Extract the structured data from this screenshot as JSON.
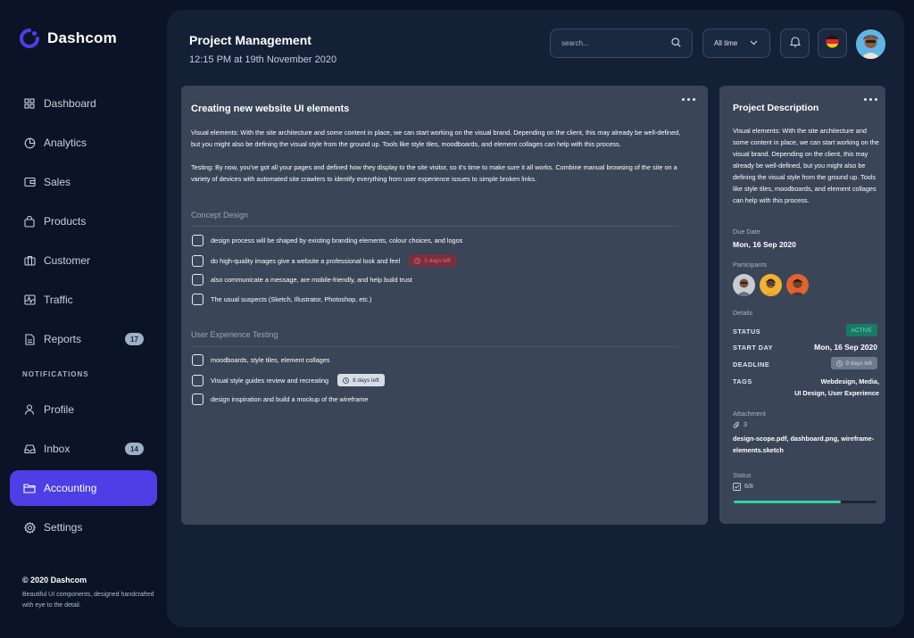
{
  "brand": {
    "name": "Dashcom",
    "accent": "#4d3ee6"
  },
  "nav": {
    "items": [
      {
        "label": "Dashboard",
        "icon": "grid-icon"
      },
      {
        "label": "Analytics",
        "icon": "pie-chart-icon"
      },
      {
        "label": "Sales",
        "icon": "wallet-icon"
      },
      {
        "label": "Products",
        "icon": "shopping-bag-icon"
      },
      {
        "label": "Customer",
        "icon": "briefcase-icon"
      },
      {
        "label": "Traffic",
        "icon": "activity-icon"
      },
      {
        "label": "Reports",
        "icon": "document-icon",
        "badge": "17"
      }
    ],
    "section_label": "NOTIFICATIONS",
    "items2": [
      {
        "label": "Profile",
        "icon": "user-icon"
      },
      {
        "label": "Inbox",
        "icon": "inbox-icon",
        "badge": "14"
      },
      {
        "label": "Accounting",
        "icon": "folder-icon",
        "active": true
      },
      {
        "label": "Settings",
        "icon": "gear-icon"
      }
    ]
  },
  "footer": {
    "copyright": "© 2020 Dashcom",
    "description": "Beautiful UI components, designed handcrafted with eye to the detail."
  },
  "header": {
    "title": "Project Management",
    "subtitle": "12:15 PM at 19th November 2020",
    "search_placeholder": "search...",
    "filter_label": "All time"
  },
  "task": {
    "title": "Creating new website UI elements",
    "paragraph1": "Visual elements: With the site architecture and some content in place, we can start working on the visual brand. Depending on the client, this may already be well-defined, but you might also be defining the visual style from the ground up. Tools like style tiles, moodboards, and element collages can help with this process.",
    "paragraph2": "Testing: By now, you've got all your pages and defined how they display to the site visitor, so it's time to make sure it all works. Combine manual browsing of the site on a variety of devices with automated site crawlers to identify everything from user experience issues to simple broken links.",
    "section1": {
      "title": "Concept Design",
      "items": [
        {
          "text": "design process will  be shaped by existing branding elements, colour choices, and logos"
        },
        {
          "text": "do high-quality images give a website a professional look and feel",
          "pill": "3 days left"
        },
        {
          "text": "also communicate a message, are mobile-friendly, and help build trust"
        },
        {
          "text": "The usual suspects (Sketch, Illustrator, Photoshop, etc.)"
        }
      ]
    },
    "section2": {
      "title": "User Experience Testing",
      "items": [
        {
          "text": "moodboards, style tiles, element collages"
        },
        {
          "text": "Visual style guides review and recreating",
          "pill": "8 days left"
        },
        {
          "text": " design inspiration and build a mockup of the wireframe"
        }
      ]
    }
  },
  "description": {
    "title": "Project Description",
    "text": "Visual elements: With the site architecture and some content in place, we can start working on the visual brand. Depending on the client, this may already be well-defined, but you might also be defining the visual style from the ground up. Tools like style tiles, moodboards, and element collages can help with this process.",
    "due_label": "Due Date",
    "due_value": "Mon, 16 Sep 2020",
    "participants_label": "Participants",
    "details_label": "Details",
    "status_key": "STATUS",
    "status_value": "ACTIVE",
    "start_key": "START DAY",
    "start_value": "Mon, 16 Sep 2020",
    "deadline_key": "DEADLINE",
    "deadline_value": "9 days left",
    "tags_key": "TAGS",
    "tags_line1": "Webdesign, Media,",
    "tags_line2": "UI Design, User Experience",
    "attachment_label": "Attachment",
    "attachment_count": "3",
    "attachment_files": "design-scope.pdf, dashboard.png, wireframe-elements.sketch",
    "status_label": "Status",
    "status_count": "6/8",
    "progress": 0.75
  }
}
